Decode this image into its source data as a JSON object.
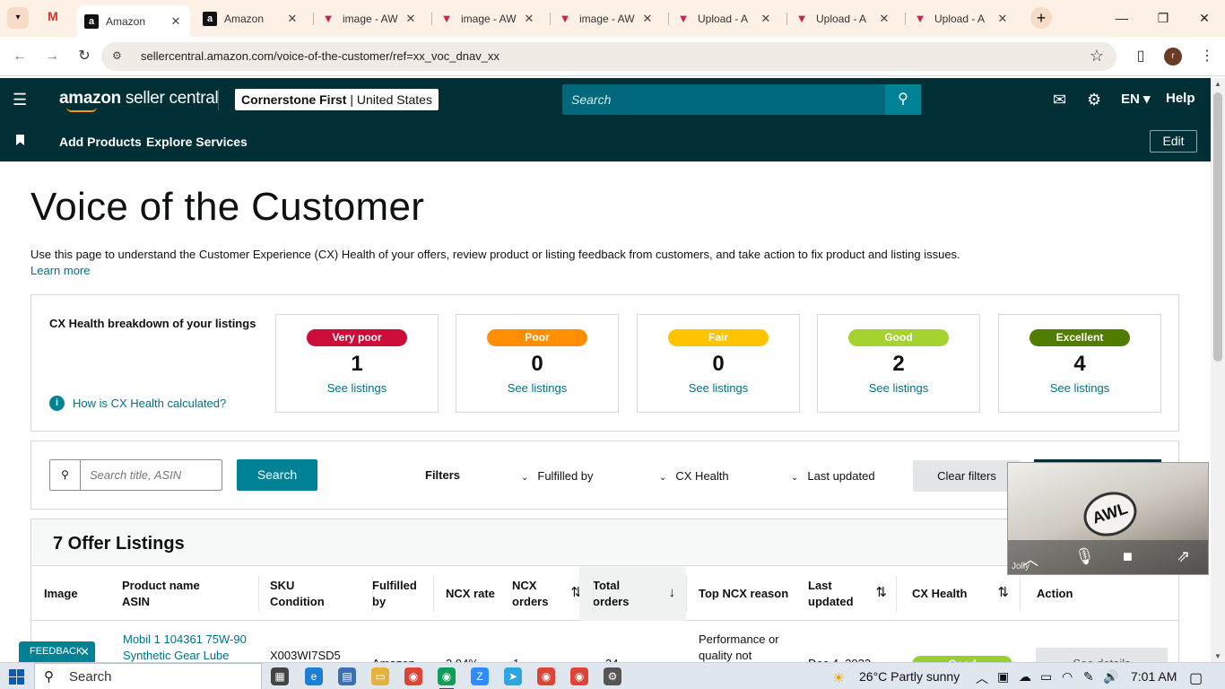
{
  "browser": {
    "tabs": [
      {
        "title": "Amazon",
        "icon": "amazon-icon",
        "active": true
      },
      {
        "title": "Amazon",
        "icon": "amazon-icon",
        "active": false
      },
      {
        "title": "image - AW",
        "icon": "aws-icon",
        "active": false
      },
      {
        "title": "image - AW",
        "icon": "aws-icon",
        "active": false
      },
      {
        "title": "image - AW",
        "icon": "aws-icon",
        "active": false
      },
      {
        "title": "Upload - A",
        "icon": "aws-icon",
        "active": false
      },
      {
        "title": "Upload - A",
        "icon": "aws-icon",
        "active": false
      },
      {
        "title": "Upload - A",
        "icon": "aws-icon",
        "active": false
      }
    ],
    "url": "sellercentral.amazon.com/voice-of-the-customer/ref=xx_voc_dnav_xx",
    "profile_initial": "r"
  },
  "header": {
    "brand_bold": "amazon",
    "brand_rest": " seller central",
    "account_name": "Cornerstone First",
    "account_region": "United States",
    "search_placeholder": "Search",
    "language": "EN",
    "help": "Help"
  },
  "subnav": {
    "items": [
      "Add Products",
      "Explore Services"
    ],
    "edit": "Edit"
  },
  "page": {
    "title": "Voice of the Customer",
    "intro": "Use this page to understand the Customer Experience (CX) Health of your offers, review product or listing feedback from customers, and take action to fix product and listing issues.",
    "learn_more": "Learn more"
  },
  "cx_health": {
    "label": "CX Health breakdown of your listings",
    "how_link": "How is CX Health calculated?",
    "cards": [
      {
        "label": "Very poor",
        "count": "1",
        "link": "See listings",
        "color": "#cc0c39",
        "text_color": "#ffffff"
      },
      {
        "label": "Poor",
        "count": "0",
        "link": "See listings",
        "color": "#ff8f00",
        "text_color": "#ffffff"
      },
      {
        "label": "Fair",
        "count": "0",
        "link": "See listings",
        "color": "#ffc400",
        "text_color": "#ffffff"
      },
      {
        "label": "Good",
        "count": "2",
        "link": "See listings",
        "color": "#a4d22f",
        "text_color": "#ffffff"
      },
      {
        "label": "Excellent",
        "count": "4",
        "link": "See listings",
        "color": "#507c00",
        "text_color": "#ffffff"
      }
    ]
  },
  "filters": {
    "search_placeholder": "Search title, ASIN",
    "search_button": "Search",
    "label": "Filters",
    "dropdowns": [
      "Fulfilled by",
      "CX Health",
      "Last updated"
    ],
    "clear": "Clear filters"
  },
  "listings": {
    "heading": "7 Offer Listings",
    "columns": [
      {
        "line1": "Image",
        "line2": ""
      },
      {
        "line1": "Product name",
        "line2": "ASIN"
      },
      {
        "line1": "SKU",
        "line2": "Condition"
      },
      {
        "line1": "Fulfilled",
        "line2": "by"
      },
      {
        "line1": "NCX rate",
        "line2": ""
      },
      {
        "line1": "NCX",
        "line2": "orders"
      },
      {
        "line1": "Total",
        "line2": "orders"
      },
      {
        "line1": "Top NCX reason",
        "line2": ""
      },
      {
        "line1": "Last",
        "line2": "updated"
      },
      {
        "line1": "CX Health",
        "line2": ""
      },
      {
        "line1": "Action",
        "line2": ""
      }
    ],
    "first_row": {
      "product_name": "Mobil 1 104361 75W-90 Synthetic Gear Lube",
      "sku": "X003WI7SD5",
      "fulfilled_by": "Amazon",
      "ncx_rate": "2.94%",
      "ncx_orders": "1",
      "total_orders": "34",
      "top_reason": "Performance or quality not",
      "last_updated": "Dec 4, 2023",
      "cx_health": "Good",
      "action": "See details"
    }
  },
  "feedback": {
    "label": "FEEDBACK"
  },
  "video": {
    "participant": "Jolly",
    "logo": "AWL"
  },
  "taskbar": {
    "search": "Search",
    "weather": "26°C  Partly sunny",
    "time": "7:01 AM"
  }
}
